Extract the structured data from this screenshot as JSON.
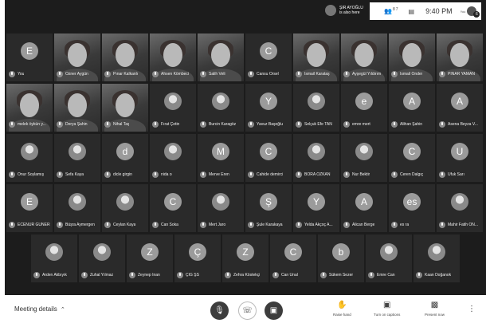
{
  "notification": {
    "name": "ŞIR AYOĞLU",
    "text": "is also here"
  },
  "status": {
    "people_count": "87",
    "time": "9:40 PM",
    "you_label": "You",
    "badge": "6"
  },
  "meeting_details": "Meeting details",
  "toolbar": {
    "raise_hand": "Raise hand",
    "captions": "Turn on captions",
    "present": "Present now"
  },
  "rows": [
    {
      "tiles": [
        {
          "name": "You",
          "initial": "E",
          "kind": "letter"
        },
        {
          "name": "Özner Aygün",
          "kind": "photo"
        },
        {
          "name": "Pınar Kalkanlı",
          "kind": "photo"
        },
        {
          "name": "Ahsen Kömbeci",
          "kind": "photo"
        },
        {
          "name": "Salih Veli",
          "kind": "photo"
        },
        {
          "name": "Cansu Örsel",
          "initial": "C",
          "kind": "letter"
        },
        {
          "name": "İsmail Karataş",
          "kind": "photo"
        },
        {
          "name": "Ayşegül Yıldırım",
          "kind": "photo"
        },
        {
          "name": "İsmail Önder",
          "kind": "photo"
        },
        {
          "name": "PINAR YAMAN",
          "kind": "photo"
        }
      ]
    },
    {
      "tiles": [
        {
          "name": "melek öykün y...",
          "kind": "photo"
        },
        {
          "name": "Derya Şahin",
          "kind": "photo"
        },
        {
          "name": "Nihal Taş",
          "kind": "photo"
        },
        {
          "name": "Fırat Çetin",
          "kind": "image"
        },
        {
          "name": "Burcin Karagöz",
          "kind": "image"
        },
        {
          "name": "Yavuz Başoğlu",
          "initial": "Y",
          "kind": "letter"
        },
        {
          "name": "Selçuk Efe TAN",
          "kind": "image"
        },
        {
          "name": "emre mert",
          "initial": "e",
          "kind": "letter"
        },
        {
          "name": "Alihan Şahin",
          "initial": "A",
          "kind": "letter"
        },
        {
          "name": "Asena Beyza V...",
          "initial": "A",
          "kind": "letter"
        }
      ]
    },
    {
      "tiles": [
        {
          "name": "Onur Soylamış",
          "kind": "image"
        },
        {
          "name": "Sefa Kaya",
          "kind": "image"
        },
        {
          "name": "dicle girgin",
          "initial": "d",
          "kind": "letter"
        },
        {
          "name": "nida o",
          "kind": "image"
        },
        {
          "name": "Merve Eren",
          "initial": "M",
          "kind": "letter"
        },
        {
          "name": "Cahide demirci",
          "initial": "C",
          "kind": "letter"
        },
        {
          "name": "BORA ÖZKAN",
          "kind": "image"
        },
        {
          "name": "Nur Bektir",
          "kind": "image"
        },
        {
          "name": "Ceren Dalgıç",
          "initial": "C",
          "kind": "letter"
        },
        {
          "name": "Ufuk Sarı",
          "initial": "U",
          "kind": "letter"
        }
      ]
    },
    {
      "tiles": [
        {
          "name": "ECENUR GÜNER",
          "initial": "E",
          "kind": "letter"
        },
        {
          "name": "Büşra Aymergen",
          "kind": "image"
        },
        {
          "name": "Ceylan Kaya",
          "kind": "image"
        },
        {
          "name": "Can Soka",
          "initial": "C",
          "kind": "letter"
        },
        {
          "name": "Mert Jaro",
          "kind": "image"
        },
        {
          "name": "Şule Karakaya",
          "initial": "Ş",
          "kind": "letter"
        },
        {
          "name": "Yelda Akçoç A...",
          "initial": "Y",
          "kind": "letter"
        },
        {
          "name": "Alican Berge",
          "initial": "A",
          "kind": "letter"
        },
        {
          "name": "es ra",
          "initial": "es",
          "kind": "letter"
        },
        {
          "name": "Mahir Fatih ÖN...",
          "kind": "image"
        }
      ]
    },
    {
      "tiles": [
        {
          "name": "Arden Akbıyık",
          "kind": "image"
        },
        {
          "name": "Zuhal Yılmaz",
          "kind": "image"
        },
        {
          "name": "Zeynep İnan",
          "initial": "Z",
          "kind": "letter"
        },
        {
          "name": "ÇİĞ ŞS",
          "initial": "Ç",
          "kind": "letter"
        },
        {
          "name": "Zehra Köstekçi",
          "initial": "Z",
          "kind": "letter"
        },
        {
          "name": "Can Ünal",
          "initial": "C",
          "kind": "letter"
        },
        {
          "name": "Sükem Sezer",
          "initial": "b",
          "kind": "letter"
        },
        {
          "name": "Emre Can",
          "kind": "image"
        },
        {
          "name": "Kaan Doğanok",
          "kind": "image"
        }
      ]
    }
  ]
}
